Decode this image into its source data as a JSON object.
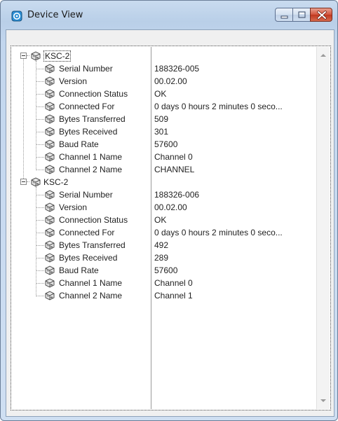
{
  "window": {
    "title": "Device View"
  },
  "icons": {
    "app": "device-view-app-icon",
    "minimize": "minimize-icon",
    "maximize": "maximize-icon",
    "close": "close-icon",
    "node": "device-node-icon"
  },
  "colors": {
    "title_bar": "#c2d6ee",
    "close_button": "#c0381f",
    "tree_background": "#ffffff"
  },
  "devices": [
    {
      "name": "KSC-2",
      "properties": [
        {
          "label": "Serial Number",
          "value": "188326-005"
        },
        {
          "label": "Version",
          "value": "00.02.00"
        },
        {
          "label": "Connection Status",
          "value": "OK"
        },
        {
          "label": "Connected For",
          "value": "0 days 0 hours 2 minutes 0 seco..."
        },
        {
          "label": "Bytes Transferred",
          "value": "509"
        },
        {
          "label": "Bytes Received",
          "value": "301"
        },
        {
          "label": "Baud Rate",
          "value": "57600"
        },
        {
          "label": "Channel 1 Name",
          "value": "Channel 0"
        },
        {
          "label": "Channel 2 Name",
          "value": "CHANNEL"
        }
      ]
    },
    {
      "name": "KSC-2",
      "properties": [
        {
          "label": "Serial Number",
          "value": "188326-006"
        },
        {
          "label": "Version",
          "value": "00.02.00"
        },
        {
          "label": "Connection Status",
          "value": "OK"
        },
        {
          "label": "Connected For",
          "value": "0 days 0 hours 2 minutes 0 seco..."
        },
        {
          "label": "Bytes Transferred",
          "value": "492"
        },
        {
          "label": "Bytes Received",
          "value": "289"
        },
        {
          "label": "Baud Rate",
          "value": "57600"
        },
        {
          "label": "Channel 1 Name",
          "value": "Channel 0"
        },
        {
          "label": "Channel 2 Name",
          "value": "Channel 1"
        }
      ]
    }
  ]
}
